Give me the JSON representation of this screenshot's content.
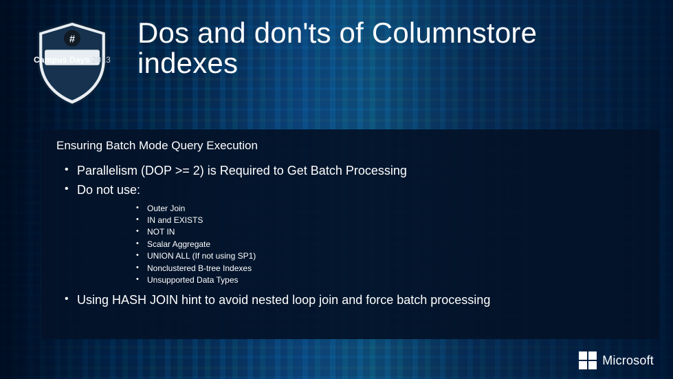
{
  "badge": {
    "label": "Campus Days",
    "year": "2013"
  },
  "title": "Dos and don'ts of Columnstore indexes",
  "panel": {
    "heading": "Ensuring Batch Mode Query Execution",
    "points": [
      "Parallelism (DOP >= 2) is Required to Get Batch Processing",
      "Do not use:",
      "Using HASH JOIN hint to avoid nested loop join and force batch processing"
    ],
    "donot_sub": [
      "Outer Join",
      "IN and EXISTS",
      "NOT IN",
      "Scalar Aggregate",
      "UNION ALL (If not using  SP1)",
      "Nonclustered B-tree Indexes",
      "Unsupported Data Types"
    ]
  },
  "footer": {
    "brand": "Microsoft"
  }
}
